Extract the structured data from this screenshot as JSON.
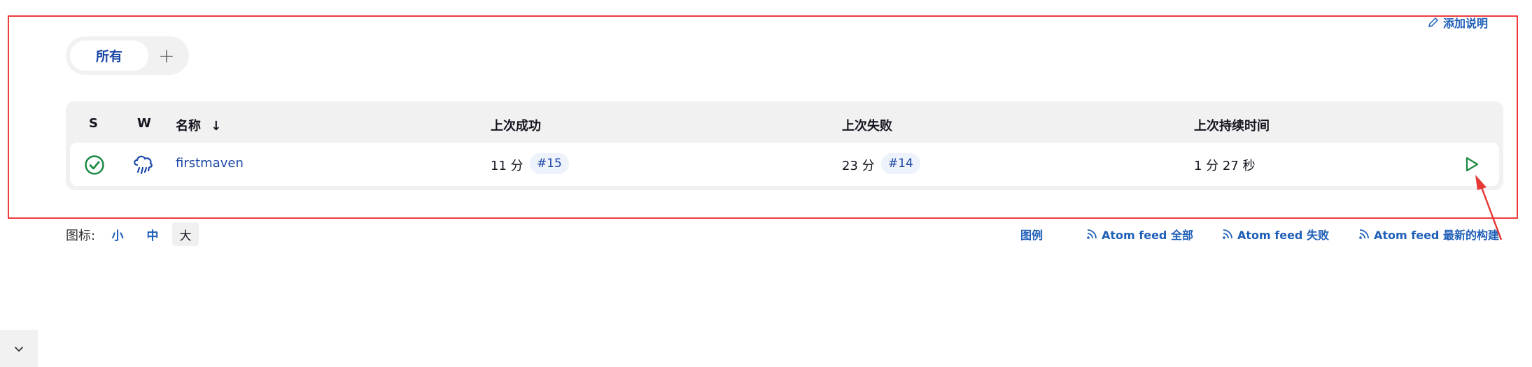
{
  "header": {
    "add_description": "添加说明"
  },
  "view_tabs": {
    "active": "所有",
    "add": "+"
  },
  "table": {
    "columns": {
      "status": "S",
      "weather": "W",
      "name": "名称",
      "sort_indicator": "↓",
      "last_success": "上次成功",
      "last_failure": "上次失败",
      "last_duration": "上次持续时间"
    },
    "rows": [
      {
        "status_icon": "success-check-icon",
        "weather_icon": "rain-cloud-icon",
        "name": "firstmaven",
        "last_success": "11 分",
        "last_success_build": "#15",
        "last_failure": "23 分",
        "last_failure_build": "#14",
        "last_duration": "1 分 27 秒",
        "action_icon": "play-build-icon"
      }
    ]
  },
  "footer": {
    "icon_label": "图标:",
    "sizes": {
      "small": "小",
      "medium": "中",
      "large": "大"
    },
    "legend": "图例",
    "feed_all": "Atom feed 全部",
    "feed_failed": "Atom feed 失败",
    "feed_latest": "Atom feed 最新的构建"
  },
  "colors": {
    "highlight": "#ee3c3c",
    "link": "#1a46a6",
    "success": "#1e8a45",
    "arrow": "#e53935"
  }
}
